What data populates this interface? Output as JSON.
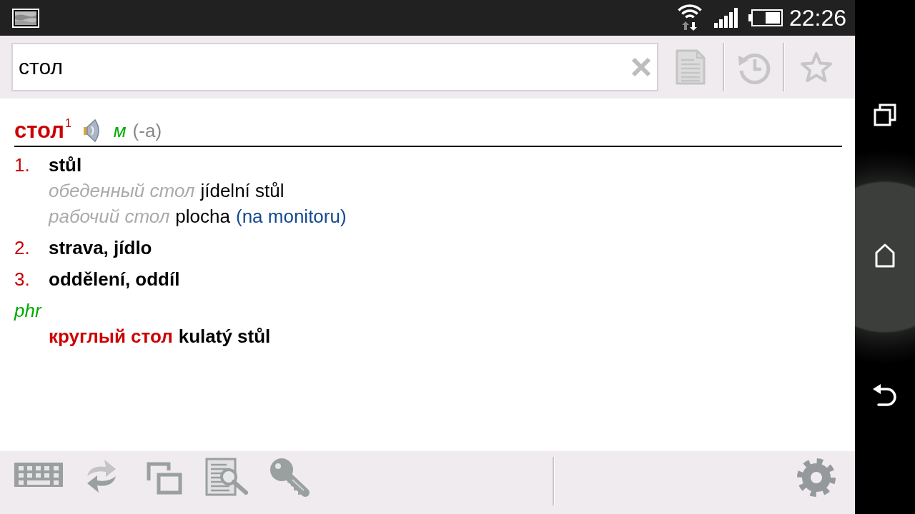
{
  "status_bar": {
    "time": "22:26"
  },
  "search": {
    "value": "стол"
  },
  "entry": {
    "headword": "стол$^{1}$",
    "gender": "м",
    "inflection": "(-а)",
    "senses": [
      {
        "number": "1.",
        "translation": "stůl",
        "examples": [
          {
            "source": "обеденный стол",
            "target": "jídelní stůl"
          },
          {
            "source": "рабочий стол",
            "target": "plocha",
            "note": "(na monitoru)"
          }
        ]
      },
      {
        "number": "2.",
        "translation": "strava, jídlo"
      },
      {
        "number": "3.",
        "translation": "oddělení, oddíl"
      }
    ],
    "phrases": {
      "label": "phr",
      "items": [
        {
          "source": "круглый стол",
          "target": "kulatý stůl"
        }
      ]
    }
  }
}
